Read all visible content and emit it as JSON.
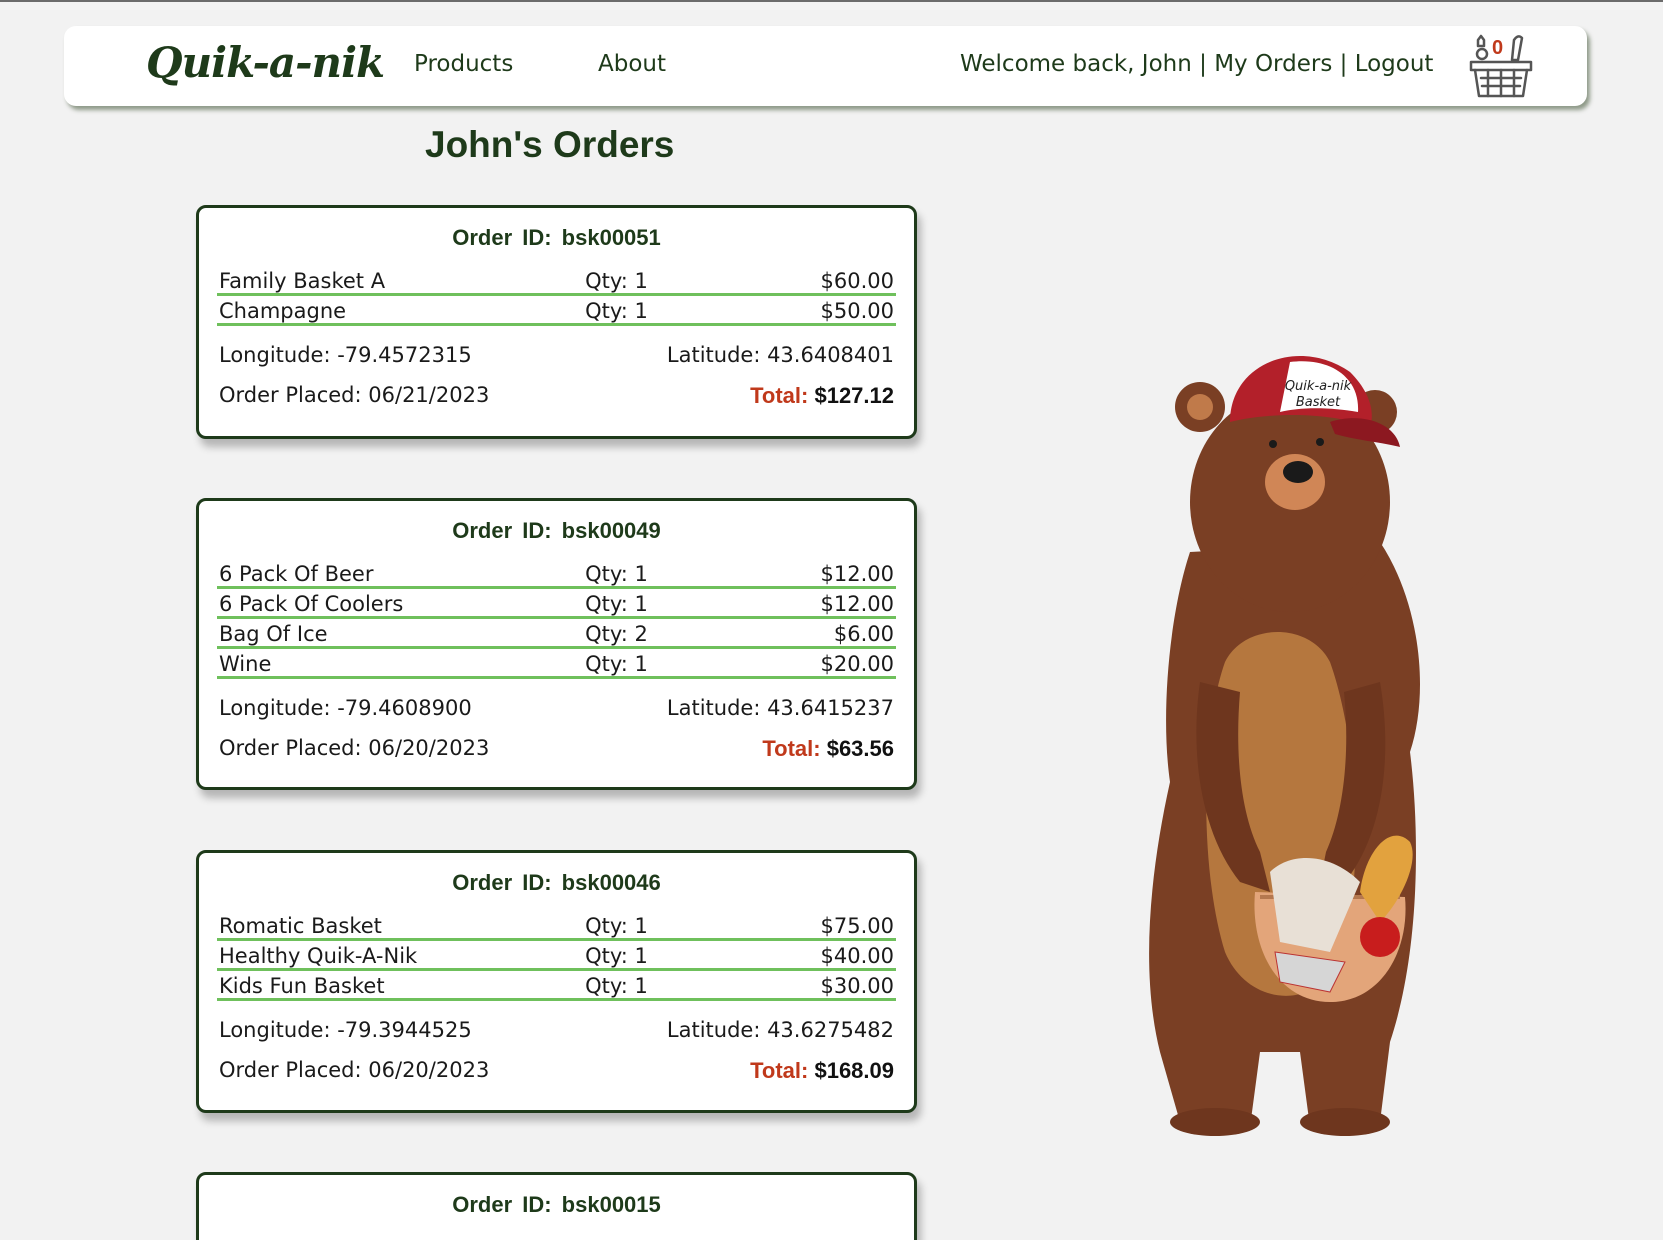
{
  "nav": {
    "logo": "Quik-a-nik",
    "products": "Products",
    "about": "About",
    "welcome": "Welcome back, John",
    "sep1": " | ",
    "my_orders": "My Orders",
    "sep2": " | ",
    "logout": "Logout",
    "cart_count": "0"
  },
  "page": {
    "title": "John's Orders"
  },
  "orders": [
    {
      "id_label": "Order ID:  bsk00051",
      "items": [
        {
          "name": "Family Basket A",
          "qty": "Qty: 1",
          "price": "$60.00"
        },
        {
          "name": "Champagne",
          "qty": "Qty: 1",
          "price": "$50.00"
        }
      ],
      "longitude": "Longitude: -79.4572315",
      "latitude": "Latitude: 43.6408401",
      "placed": "Order Placed: 06/21/2023",
      "total_label": "Total:",
      "total_value": "$127.12"
    },
    {
      "id_label": "Order ID:  bsk00049",
      "items": [
        {
          "name": "6 Pack Of Beer",
          "qty": "Qty: 1",
          "price": "$12.00"
        },
        {
          "name": "6 Pack Of Coolers",
          "qty": "Qty: 1",
          "price": "$12.00"
        },
        {
          "name": "Bag Of Ice",
          "qty": "Qty: 2",
          "price": "$6.00"
        },
        {
          "name": "Wine",
          "qty": "Qty: 1",
          "price": "$20.00"
        }
      ],
      "longitude": "Longitude: -79.4608900",
      "latitude": "Latitude: 43.6415237",
      "placed": "Order Placed: 06/20/2023",
      "total_label": "Total:",
      "total_value": "$63.56"
    },
    {
      "id_label": "Order ID:  bsk00046",
      "items": [
        {
          "name": "Romatic Basket",
          "qty": "Qty: 1",
          "price": "$75.00"
        },
        {
          "name": "Healthy Quik-A-Nik",
          "qty": "Qty: 1",
          "price": "$40.00"
        },
        {
          "name": "Kids Fun Basket",
          "qty": "Qty: 1",
          "price": "$30.00"
        }
      ],
      "longitude": "Longitude: -79.3944525",
      "latitude": "Latitude: 43.6275482",
      "placed": "Order Placed: 06/20/2023",
      "total_label": "Total:",
      "total_value": "$168.09"
    },
    {
      "id_label": "Order ID:  bsk00015"
    }
  ],
  "mascot": {
    "cap_text_1": "Quik-a-nik",
    "cap_text_2": "Basket"
  },
  "colors": {
    "brand_green": "#1e3a1a",
    "row_line": "#6fc05c",
    "accent_red": "#c0391b"
  },
  "icons": {
    "cart": "basket-icon"
  }
}
